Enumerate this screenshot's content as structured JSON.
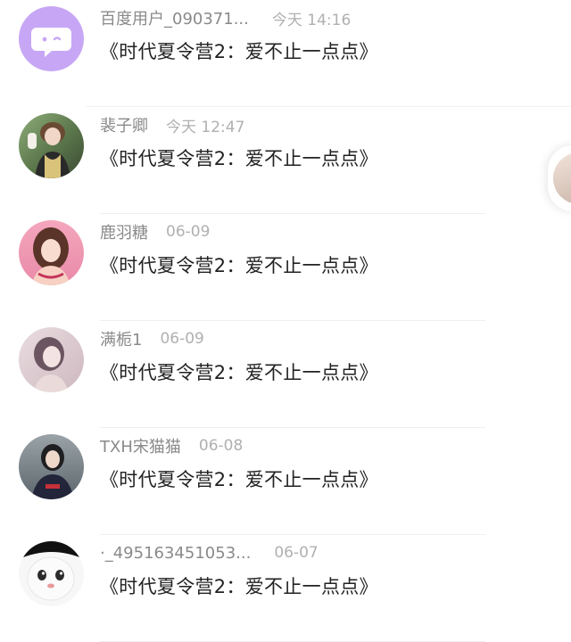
{
  "conversations": [
    {
      "name": "百度用户_090371...",
      "time": "今天 14:16",
      "message": "《时代夏令营2：爱不止一点点》",
      "avatar": "default-chat-bubble-avatar"
    },
    {
      "name": "裴子卿",
      "time": "今天 12:47",
      "message": "《时代夏令营2：爱不止一点点》",
      "avatar": "user-photo-avatar"
    },
    {
      "name": "鹿羽糖",
      "time": "06-09",
      "message": "《时代夏令营2：爱不止一点点》",
      "avatar": "user-photo-avatar"
    },
    {
      "name": "满栀1",
      "time": "06-09",
      "message": "《时代夏令营2：爱不止一点点》",
      "avatar": "user-photo-avatar"
    },
    {
      "name": "TXH宋猫猫",
      "time": "06-08",
      "message": "《时代夏令营2：爱不止一点点》",
      "avatar": "user-photo-avatar"
    },
    {
      "name": "·_495163451053...",
      "time": "06-07",
      "message": "《时代夏令营2：爱不止一点点》",
      "avatar": "cartoon-face-avatar"
    }
  ],
  "colors": {
    "default_avatar_bg": "#c7a7f5",
    "name_text": "#8a8a8a",
    "time_text": "#b0b0b0",
    "message_text": "#222222",
    "divider": "#efefef"
  }
}
